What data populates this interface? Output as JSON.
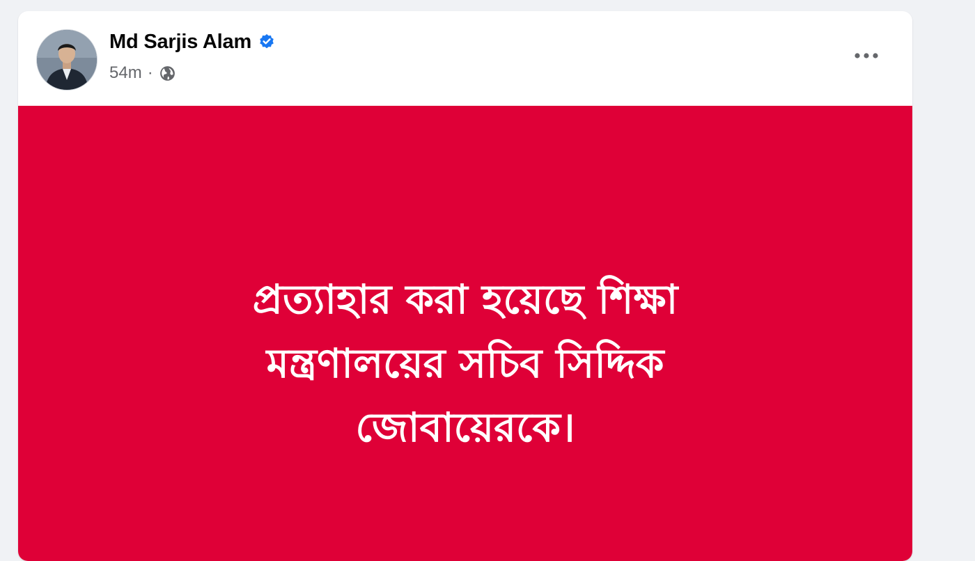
{
  "post": {
    "author": {
      "name": "Md Sarjis Alam",
      "verified": true
    },
    "timestamp": "54m",
    "separator": "·",
    "audience_icon": "globe-icon",
    "more_icon": "more-options-icon",
    "media": {
      "background_color": "#df0037",
      "text_color": "#ffffff",
      "lines": [
        "প্রত্যাহার করা হয়েছে শিক্ষা",
        "মন্ত্রণালয়ের সচিব সিদ্দিক",
        "জোবায়েরকে।"
      ]
    }
  },
  "colors": {
    "page_background": "#f0f2f5",
    "card_background": "#ffffff",
    "verified_blue": "#1877f2",
    "secondary_text": "#65676b"
  }
}
